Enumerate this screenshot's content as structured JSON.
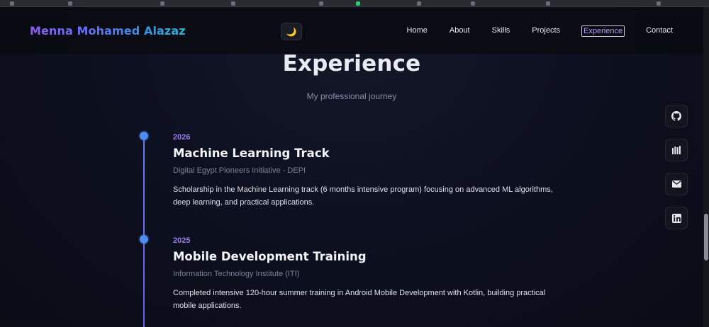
{
  "navbar": {
    "brand": "Menna Mohamed Alazaz",
    "theme_toggle_icon": "moon-icon",
    "links": [
      {
        "label": "Home",
        "active": false
      },
      {
        "label": "About",
        "active": false
      },
      {
        "label": "Skills",
        "active": false
      },
      {
        "label": "Projects",
        "active": false
      },
      {
        "label": "Experience",
        "active": true
      },
      {
        "label": "Contact",
        "active": false
      }
    ]
  },
  "section": {
    "title": "Experience",
    "subtitle": "My professional journey"
  },
  "experience": [
    {
      "year": "2026",
      "title": "Machine Learning Track",
      "organization": "Digital Egypt Pioneers Initiative - DEPI",
      "description": "Scholarship in the Machine Learning track (6 months intensive program) focusing on advanced ML algorithms, deep learning, and practical applications."
    },
    {
      "year": "2025",
      "title": "Mobile Development Training",
      "organization": "Information Technology Institute (ITI)",
      "description": "Completed intensive 120-hour summer training in Android Mobile Development with Kotlin, building practical mobile applications."
    }
  ],
  "social_links": [
    {
      "icon": "github-icon"
    },
    {
      "icon": "kaggle-icon"
    },
    {
      "icon": "email-icon"
    },
    {
      "icon": "linkedin-icon"
    }
  ],
  "colors": {
    "accent_purple": "#9b7cf4",
    "timeline_blue": "#4f8cf3",
    "background": "#0c0e18"
  }
}
